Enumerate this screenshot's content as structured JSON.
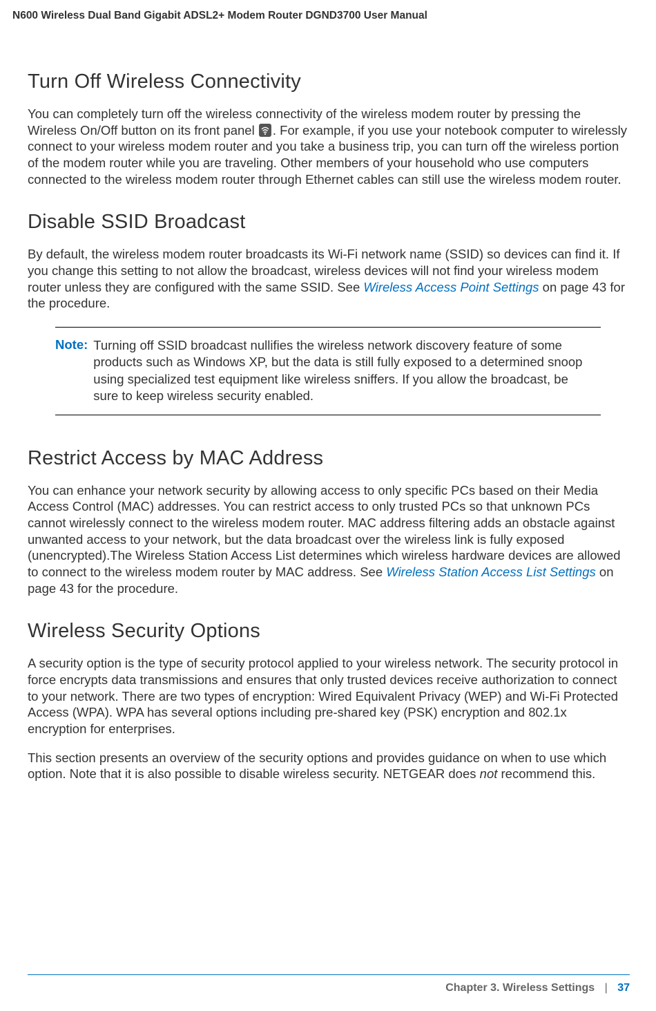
{
  "header": {
    "title": "N600 Wireless Dual Band Gigabit ADSL2+ Modem Router DGND3700 User Manual"
  },
  "sections": {
    "s1": {
      "heading": "Turn Off Wireless Connectivity",
      "p1a": "You can completely turn off the wireless connectivity of the wireless modem router by pressing the Wireless On/Off button on its front panel",
      "p1b": ". For example, if you use your notebook computer to wirelessly connect to your wireless modem router and you take a business trip, you can turn off the wireless portion of the modem router while you are traveling. Other members of your household who use computers connected to the wireless modem router through Ethernet cables can still use the wireless modem router."
    },
    "s2": {
      "heading": "Disable SSID Broadcast",
      "p1a": "By default, the wireless modem router broadcasts its Wi-Fi network name (SSID) so devices can find it. If you change this setting to not allow the broadcast, wireless devices will not find your wireless modem router unless they are configured with the same SSID. See ",
      "link1": "Wireless Access Point Settings",
      "p1b": " on page 43 for the procedure.",
      "note_label": "Note:",
      "note_text": "Turning off SSID broadcast nullifies the wireless network discovery feature of some products such as Windows XP, but the data is still fully exposed to a determined snoop using specialized test equipment like wireless sniffers. If you allow the broadcast, be sure to keep wireless security enabled."
    },
    "s3": {
      "heading": "Restrict Access by MAC Address",
      "p1a": "You can enhance your network security by allowing access to only specific PCs based on their Media Access Control (MAC) addresses. You can restrict access to only trusted PCs so that unknown PCs cannot wirelessly connect to the wireless modem router. MAC address filtering adds an obstacle against unwanted access to your network, but the data broadcast over the wireless link is fully exposed (unencrypted).The Wireless Station Access List determines which wireless hardware devices are allowed to connect to the wireless modem router by MAC address. See ",
      "link1": "Wireless Station Access List Settings",
      "p1b": " on page 43 for the procedure."
    },
    "s4": {
      "heading": "Wireless Security Options",
      "p1": "A security option is the type of security protocol applied to your wireless network. The security protocol in force encrypts data transmissions and ensures that only trusted devices receive authorization to connect to your network. There are two types of encryption: Wired Equivalent Privacy (WEP) and Wi-Fi Protected Access (WPA). WPA has several options including pre-shared key (PSK) encryption and 802.1x encryption for enterprises.",
      "p2a": "This section presents an overview of the security options and provides guidance on when to use which option. Note that it is also possible to disable wireless security. NETGEAR does ",
      "p2_not": "not",
      "p2b": " recommend this."
    }
  },
  "footer": {
    "chapter": "Chapter 3.  Wireless Settings",
    "sep": "|",
    "page": "37"
  }
}
